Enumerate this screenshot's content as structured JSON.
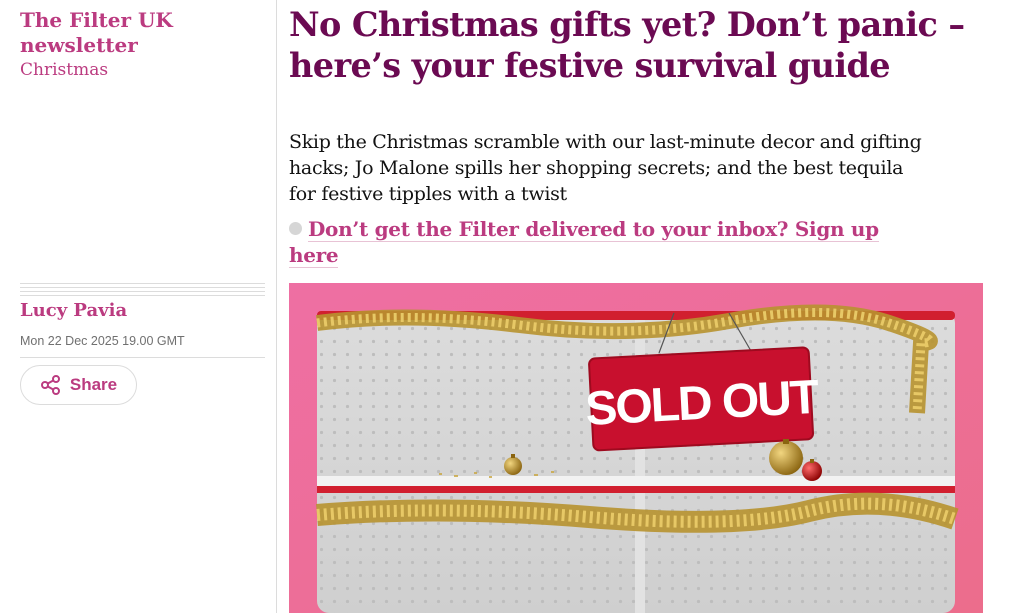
{
  "colors": {
    "section_pink": "#bb3b80",
    "headline_purple": "#6b0a52",
    "text": "#121212",
    "hero_pink": "#ee6fa3",
    "sign_red": "#c8102e",
    "tinsel_gold": "#c9a640"
  },
  "section": {
    "title": "The Filter UK newsletter",
    "subtitle": "Christmas"
  },
  "byline": {
    "author": "Lucy Pavia",
    "date": "Mon 22 Dec 2025 19.00 GMT"
  },
  "share": {
    "label": "Share",
    "icon": "share-icon"
  },
  "article": {
    "headline": "No Christmas gifts yet? Don’t panic – here’s your festive survival guide",
    "standfirst": "Skip the Christmas scramble with our last-minute decor and gifting hacks; Jo Malone spills her shopping secrets; and the best tequila for festive tipples with a twist",
    "signup_text": "Don’t get the Filter delivered to your inbox? Sign up here"
  },
  "hero_image": {
    "sign_text": "SOLD OUT"
  }
}
